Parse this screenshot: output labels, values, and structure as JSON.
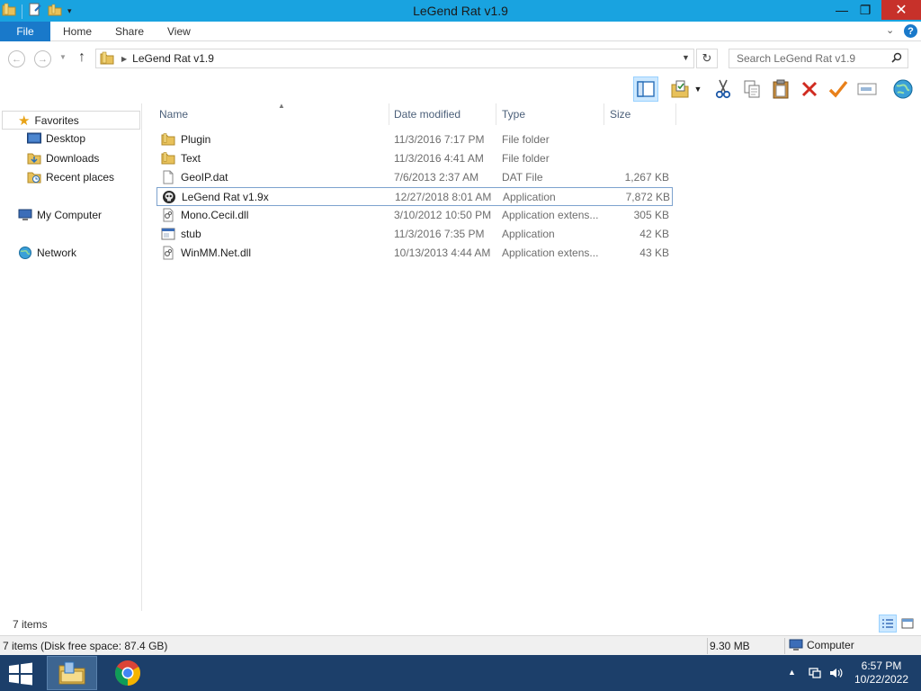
{
  "window": {
    "title": "LeGend Rat v1.9",
    "minimize_glyph": "—",
    "maximize_glyph": "❐",
    "close_glyph": "✕"
  },
  "ribbon": {
    "tabs": [
      "File",
      "Home",
      "Share",
      "View"
    ],
    "help_glyph": "?"
  },
  "navigation": {
    "back_glyph": "←",
    "forward_glyph": "→",
    "up_glyph": "↑",
    "address_path": "LeGend Rat v1.9",
    "search_placeholder": "Search LeGend Rat v1.9"
  },
  "toolbar": {
    "icons": [
      "preview-pane-icon",
      "properties-folder-icon",
      "cut-icon",
      "copy-icon",
      "paste-icon",
      "delete-icon",
      "check-icon",
      "rename-icon",
      "globe-icon"
    ]
  },
  "nav_pane": {
    "favorites": "Favorites",
    "desktop": "Desktop",
    "downloads": "Downloads",
    "recent_places": "Recent places",
    "my_computer": "My Computer",
    "network": "Network"
  },
  "file_list": {
    "columns": [
      "Name",
      "Date modified",
      "Type",
      "Size"
    ],
    "rows": [
      {
        "name": "Plugin",
        "date": "11/3/2016 7:17 PM",
        "type": "File folder",
        "size": "",
        "icon": "folder-icon"
      },
      {
        "name": "Text",
        "date": "11/3/2016 4:41 AM",
        "type": "File folder",
        "size": "",
        "icon": "folder-icon"
      },
      {
        "name": "GeoIP.dat",
        "date": "7/6/2013 2:37 AM",
        "type": "DAT File",
        "size": "1,267 KB",
        "icon": "file-icon"
      },
      {
        "name": "LeGend Rat v1.9x",
        "date": "12/27/2018 8:01 AM",
        "type": "Application",
        "size": "7,872 KB",
        "icon": "app-skull-icon",
        "selected": true
      },
      {
        "name": "Mono.Cecil.dll",
        "date": "3/10/2012 10:50 PM",
        "type": "Application extens...",
        "size": "305 KB",
        "icon": "dll-icon"
      },
      {
        "name": "stub",
        "date": "11/3/2016 7:35 PM",
        "type": "Application",
        "size": "42 KB",
        "icon": "exe-icon"
      },
      {
        "name": "WinMM.Net.dll",
        "date": "10/13/2013 4:44 AM",
        "type": "Application extens...",
        "size": "43 KB",
        "icon": "dll-icon"
      }
    ]
  },
  "status": {
    "item_count": "7 items",
    "disk_info": "7 items (Disk free space: 87.4 GB)",
    "selection_size": "9.30 MB",
    "location": "Computer"
  },
  "taskbar": {
    "time": "6:57 PM",
    "date": "10/22/2022"
  },
  "colors": {
    "titlebar": "#19a3e0",
    "file_tab": "#1979ca",
    "close_button": "#c7312a",
    "taskbar": "#1c3f6a",
    "folder": "#e8c15a"
  }
}
